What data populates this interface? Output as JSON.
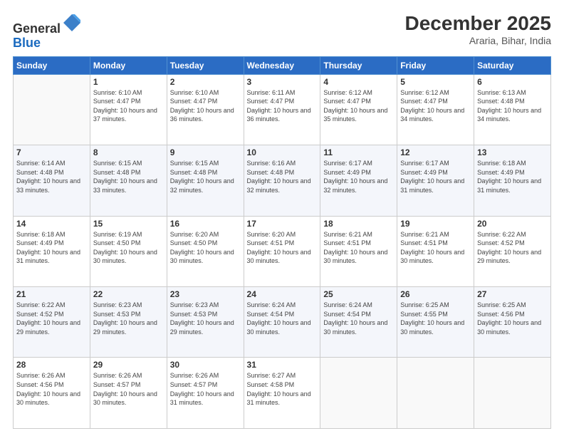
{
  "header": {
    "logo_general": "General",
    "logo_blue": "Blue",
    "month_year": "December 2025",
    "location": "Araria, Bihar, India"
  },
  "days_of_week": [
    "Sunday",
    "Monday",
    "Tuesday",
    "Wednesday",
    "Thursday",
    "Friday",
    "Saturday"
  ],
  "weeks": [
    [
      {
        "day": "",
        "sunrise": "",
        "sunset": "",
        "daylight": ""
      },
      {
        "day": "1",
        "sunrise": "6:10 AM",
        "sunset": "4:47 PM",
        "daylight": "10 hours and 37 minutes."
      },
      {
        "day": "2",
        "sunrise": "6:10 AM",
        "sunset": "4:47 PM",
        "daylight": "10 hours and 36 minutes."
      },
      {
        "day": "3",
        "sunrise": "6:11 AM",
        "sunset": "4:47 PM",
        "daylight": "10 hours and 36 minutes."
      },
      {
        "day": "4",
        "sunrise": "6:12 AM",
        "sunset": "4:47 PM",
        "daylight": "10 hours and 35 minutes."
      },
      {
        "day": "5",
        "sunrise": "6:12 AM",
        "sunset": "4:47 PM",
        "daylight": "10 hours and 34 minutes."
      },
      {
        "day": "6",
        "sunrise": "6:13 AM",
        "sunset": "4:48 PM",
        "daylight": "10 hours and 34 minutes."
      }
    ],
    [
      {
        "day": "7",
        "sunrise": "6:14 AM",
        "sunset": "4:48 PM",
        "daylight": "10 hours and 33 minutes."
      },
      {
        "day": "8",
        "sunrise": "6:15 AM",
        "sunset": "4:48 PM",
        "daylight": "10 hours and 33 minutes."
      },
      {
        "day": "9",
        "sunrise": "6:15 AM",
        "sunset": "4:48 PM",
        "daylight": "10 hours and 32 minutes."
      },
      {
        "day": "10",
        "sunrise": "6:16 AM",
        "sunset": "4:48 PM",
        "daylight": "10 hours and 32 minutes."
      },
      {
        "day": "11",
        "sunrise": "6:17 AM",
        "sunset": "4:49 PM",
        "daylight": "10 hours and 32 minutes."
      },
      {
        "day": "12",
        "sunrise": "6:17 AM",
        "sunset": "4:49 PM",
        "daylight": "10 hours and 31 minutes."
      },
      {
        "day": "13",
        "sunrise": "6:18 AM",
        "sunset": "4:49 PM",
        "daylight": "10 hours and 31 minutes."
      }
    ],
    [
      {
        "day": "14",
        "sunrise": "6:18 AM",
        "sunset": "4:49 PM",
        "daylight": "10 hours and 31 minutes."
      },
      {
        "day": "15",
        "sunrise": "6:19 AM",
        "sunset": "4:50 PM",
        "daylight": "10 hours and 30 minutes."
      },
      {
        "day": "16",
        "sunrise": "6:20 AM",
        "sunset": "4:50 PM",
        "daylight": "10 hours and 30 minutes."
      },
      {
        "day": "17",
        "sunrise": "6:20 AM",
        "sunset": "4:51 PM",
        "daylight": "10 hours and 30 minutes."
      },
      {
        "day": "18",
        "sunrise": "6:21 AM",
        "sunset": "4:51 PM",
        "daylight": "10 hours and 30 minutes."
      },
      {
        "day": "19",
        "sunrise": "6:21 AM",
        "sunset": "4:51 PM",
        "daylight": "10 hours and 30 minutes."
      },
      {
        "day": "20",
        "sunrise": "6:22 AM",
        "sunset": "4:52 PM",
        "daylight": "10 hours and 29 minutes."
      }
    ],
    [
      {
        "day": "21",
        "sunrise": "6:22 AM",
        "sunset": "4:52 PM",
        "daylight": "10 hours and 29 minutes."
      },
      {
        "day": "22",
        "sunrise": "6:23 AM",
        "sunset": "4:53 PM",
        "daylight": "10 hours and 29 minutes."
      },
      {
        "day": "23",
        "sunrise": "6:23 AM",
        "sunset": "4:53 PM",
        "daylight": "10 hours and 29 minutes."
      },
      {
        "day": "24",
        "sunrise": "6:24 AM",
        "sunset": "4:54 PM",
        "daylight": "10 hours and 30 minutes."
      },
      {
        "day": "25",
        "sunrise": "6:24 AM",
        "sunset": "4:54 PM",
        "daylight": "10 hours and 30 minutes."
      },
      {
        "day": "26",
        "sunrise": "6:25 AM",
        "sunset": "4:55 PM",
        "daylight": "10 hours and 30 minutes."
      },
      {
        "day": "27",
        "sunrise": "6:25 AM",
        "sunset": "4:56 PM",
        "daylight": "10 hours and 30 minutes."
      }
    ],
    [
      {
        "day": "28",
        "sunrise": "6:26 AM",
        "sunset": "4:56 PM",
        "daylight": "10 hours and 30 minutes."
      },
      {
        "day": "29",
        "sunrise": "6:26 AM",
        "sunset": "4:57 PM",
        "daylight": "10 hours and 30 minutes."
      },
      {
        "day": "30",
        "sunrise": "6:26 AM",
        "sunset": "4:57 PM",
        "daylight": "10 hours and 31 minutes."
      },
      {
        "day": "31",
        "sunrise": "6:27 AM",
        "sunset": "4:58 PM",
        "daylight": "10 hours and 31 minutes."
      },
      {
        "day": "",
        "sunrise": "",
        "sunset": "",
        "daylight": ""
      },
      {
        "day": "",
        "sunrise": "",
        "sunset": "",
        "daylight": ""
      },
      {
        "day": "",
        "sunrise": "",
        "sunset": "",
        "daylight": ""
      }
    ]
  ],
  "labels": {
    "sunrise_prefix": "Sunrise: ",
    "sunset_prefix": "Sunset: ",
    "daylight_prefix": "Daylight: "
  }
}
